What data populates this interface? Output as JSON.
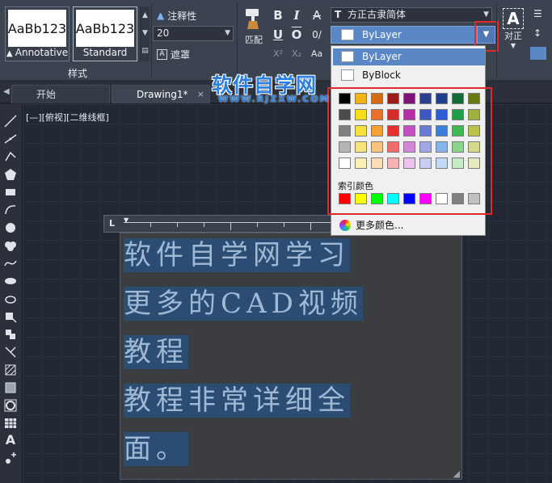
{
  "ribbon": {
    "styles": [
      {
        "preview": "AaBb123",
        "name": "Annotative"
      },
      {
        "preview": "AaBb123",
        "name": "Standard"
      }
    ],
    "styles_panel_label": "样式",
    "annotative_label": "注释性",
    "text_height": "20",
    "mask_label": "遮罩",
    "match_label": "匹配",
    "format_buttons": {
      "bold": "B",
      "italic": "I",
      "strike": "A",
      "underline": "U",
      "overline": "O",
      "oblique": "0/"
    },
    "superscript": "X²",
    "subscript": "X₂",
    "case": "Aa",
    "font_prefix": "T",
    "font_name": "方正古隶简体",
    "color_value": "ByLayer",
    "justify_label": "对正"
  },
  "tabs": [
    {
      "label": "开始"
    },
    {
      "label": "Drawing1*",
      "close": "×"
    }
  ],
  "tab_add": "+",
  "viewport_label": "[—][俯视][二维线框]",
  "ruler_mark": "L",
  "mtext": [
    "软件自学网学习",
    "更多的CAD视频",
    "教程",
    "教程非常详细全",
    "面。"
  ],
  "color_dropdown": {
    "items": [
      "ByLayer",
      "ByBlock"
    ],
    "index_label": "索引颜色",
    "more_colors": "更多颜色...",
    "grid": [
      [
        "#000000",
        "#f1b316",
        "#d66b14",
        "#9c1b1b",
        "#80127a",
        "#2b3f8c",
        "#1f3e8b",
        "#0f6b38",
        "#6a7a12"
      ],
      [
        "#4b4b4b",
        "#f7de1b",
        "#e8702a",
        "#d42b2b",
        "#b52fa6",
        "#3e58c2",
        "#2d5bd5",
        "#1f9e4a",
        "#9eb13c"
      ],
      [
        "#7f7f7f",
        "#f6e23a",
        "#f6a035",
        "#e62f2f",
        "#c44fc3",
        "#6a7bd4",
        "#3c7fdb",
        "#3fb84f",
        "#bcc34a"
      ],
      [
        "#b5b5b5",
        "#f7e57a",
        "#f8c37c",
        "#f16d6d",
        "#d487d6",
        "#9ea8e6",
        "#87b4ec",
        "#8cd48e",
        "#d4da8a"
      ],
      [
        "#ffffff",
        "#fbf0b8",
        "#fbdcb5",
        "#f7b3b3",
        "#ebc3ec",
        "#c8cdf2",
        "#c2d9f7",
        "#c6ebc6",
        "#e6e9c0"
      ]
    ],
    "index_colors": [
      "#ff0000",
      "#ffff00",
      "#00ff00",
      "#00ffff",
      "#0000ff",
      "#ff00ff",
      "#ffffff",
      "#808080",
      "#c0c0c0"
    ]
  },
  "watermark": {
    "cn": "软件自学网",
    "en": "WWW.RJZXW.COM"
  }
}
